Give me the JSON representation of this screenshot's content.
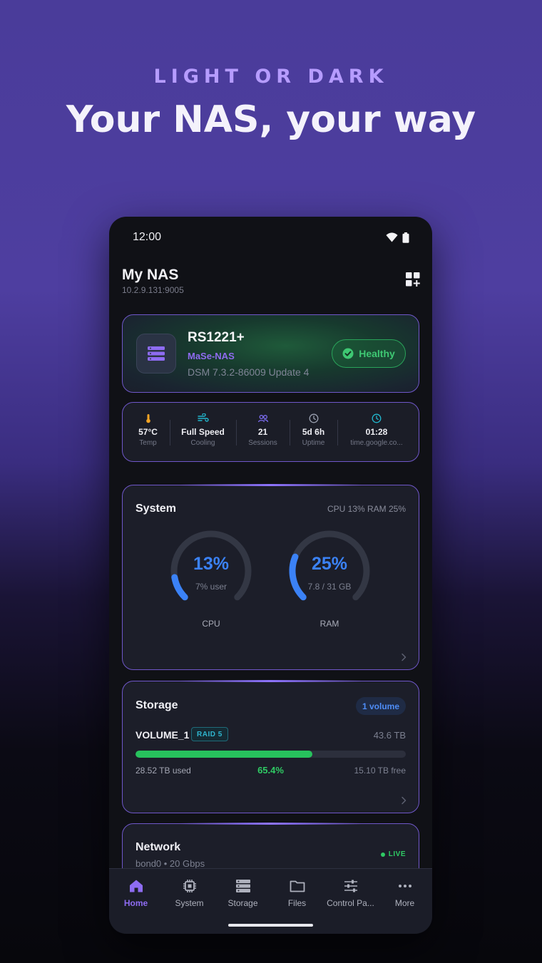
{
  "promo": {
    "eyebrow": "LIGHT OR DARK",
    "title": "Your NAS, your way"
  },
  "status_bar": {
    "time": "12:00"
  },
  "header": {
    "title": "My NAS",
    "address": "10.2.9.131:9005"
  },
  "device": {
    "model": "RS1221+",
    "name": "MaSe-NAS",
    "dsm": "DSM 7.3.2-86009 Update 4",
    "health": "Healthy"
  },
  "stats": [
    {
      "icon": "thermometer-icon",
      "value": "57°C",
      "label": "Temp",
      "color": "#f5a524"
    },
    {
      "icon": "fan-icon",
      "value": "Full Speed",
      "label": "Cooling",
      "color": "#22b8cf"
    },
    {
      "icon": "users-icon",
      "value": "21",
      "label": "Sessions",
      "color": "#7c6cf0"
    },
    {
      "icon": "clock-icon",
      "value": "5d 6h",
      "label": "Uptime",
      "color": "#9aa0b0"
    },
    {
      "icon": "sync-clock-icon",
      "value": "01:28",
      "label": "time.google.co...",
      "color": "#22b8cf"
    }
  ],
  "system": {
    "title": "System",
    "summary": "CPU 13%  RAM 25%",
    "cpu": {
      "value": "13%",
      "fraction": 0.13,
      "sub": "7% user",
      "label": "CPU"
    },
    "ram": {
      "value": "25%",
      "fraction": 0.25,
      "sub": "7.8 / 31 GB",
      "label": "RAM"
    }
  },
  "storage": {
    "title": "Storage",
    "volume_count": "1 volume",
    "volume": {
      "name": "VOLUME_1",
      "raid": "RAID 5",
      "size": "43.6 TB",
      "used": "28.52 TB used",
      "percent": "65.4%",
      "fraction": 0.654,
      "free": "15.10 TB free"
    }
  },
  "network": {
    "title": "Network",
    "sub": "bond0 • 20 Gbps",
    "badge": "LIVE"
  },
  "nav": [
    {
      "label": "Home",
      "icon": "home-icon",
      "active": true
    },
    {
      "label": "System",
      "icon": "chip-icon",
      "active": false
    },
    {
      "label": "Storage",
      "icon": "storage-icon",
      "active": false
    },
    {
      "label": "Files",
      "icon": "folder-icon",
      "active": false
    },
    {
      "label": "Control Pa...",
      "icon": "sliders-icon",
      "active": false
    },
    {
      "label": "More",
      "icon": "more-icon",
      "active": false
    }
  ],
  "colors": {
    "accent": "#8e6cf2",
    "gauge": "#3b82f6",
    "success": "#27c25d"
  }
}
